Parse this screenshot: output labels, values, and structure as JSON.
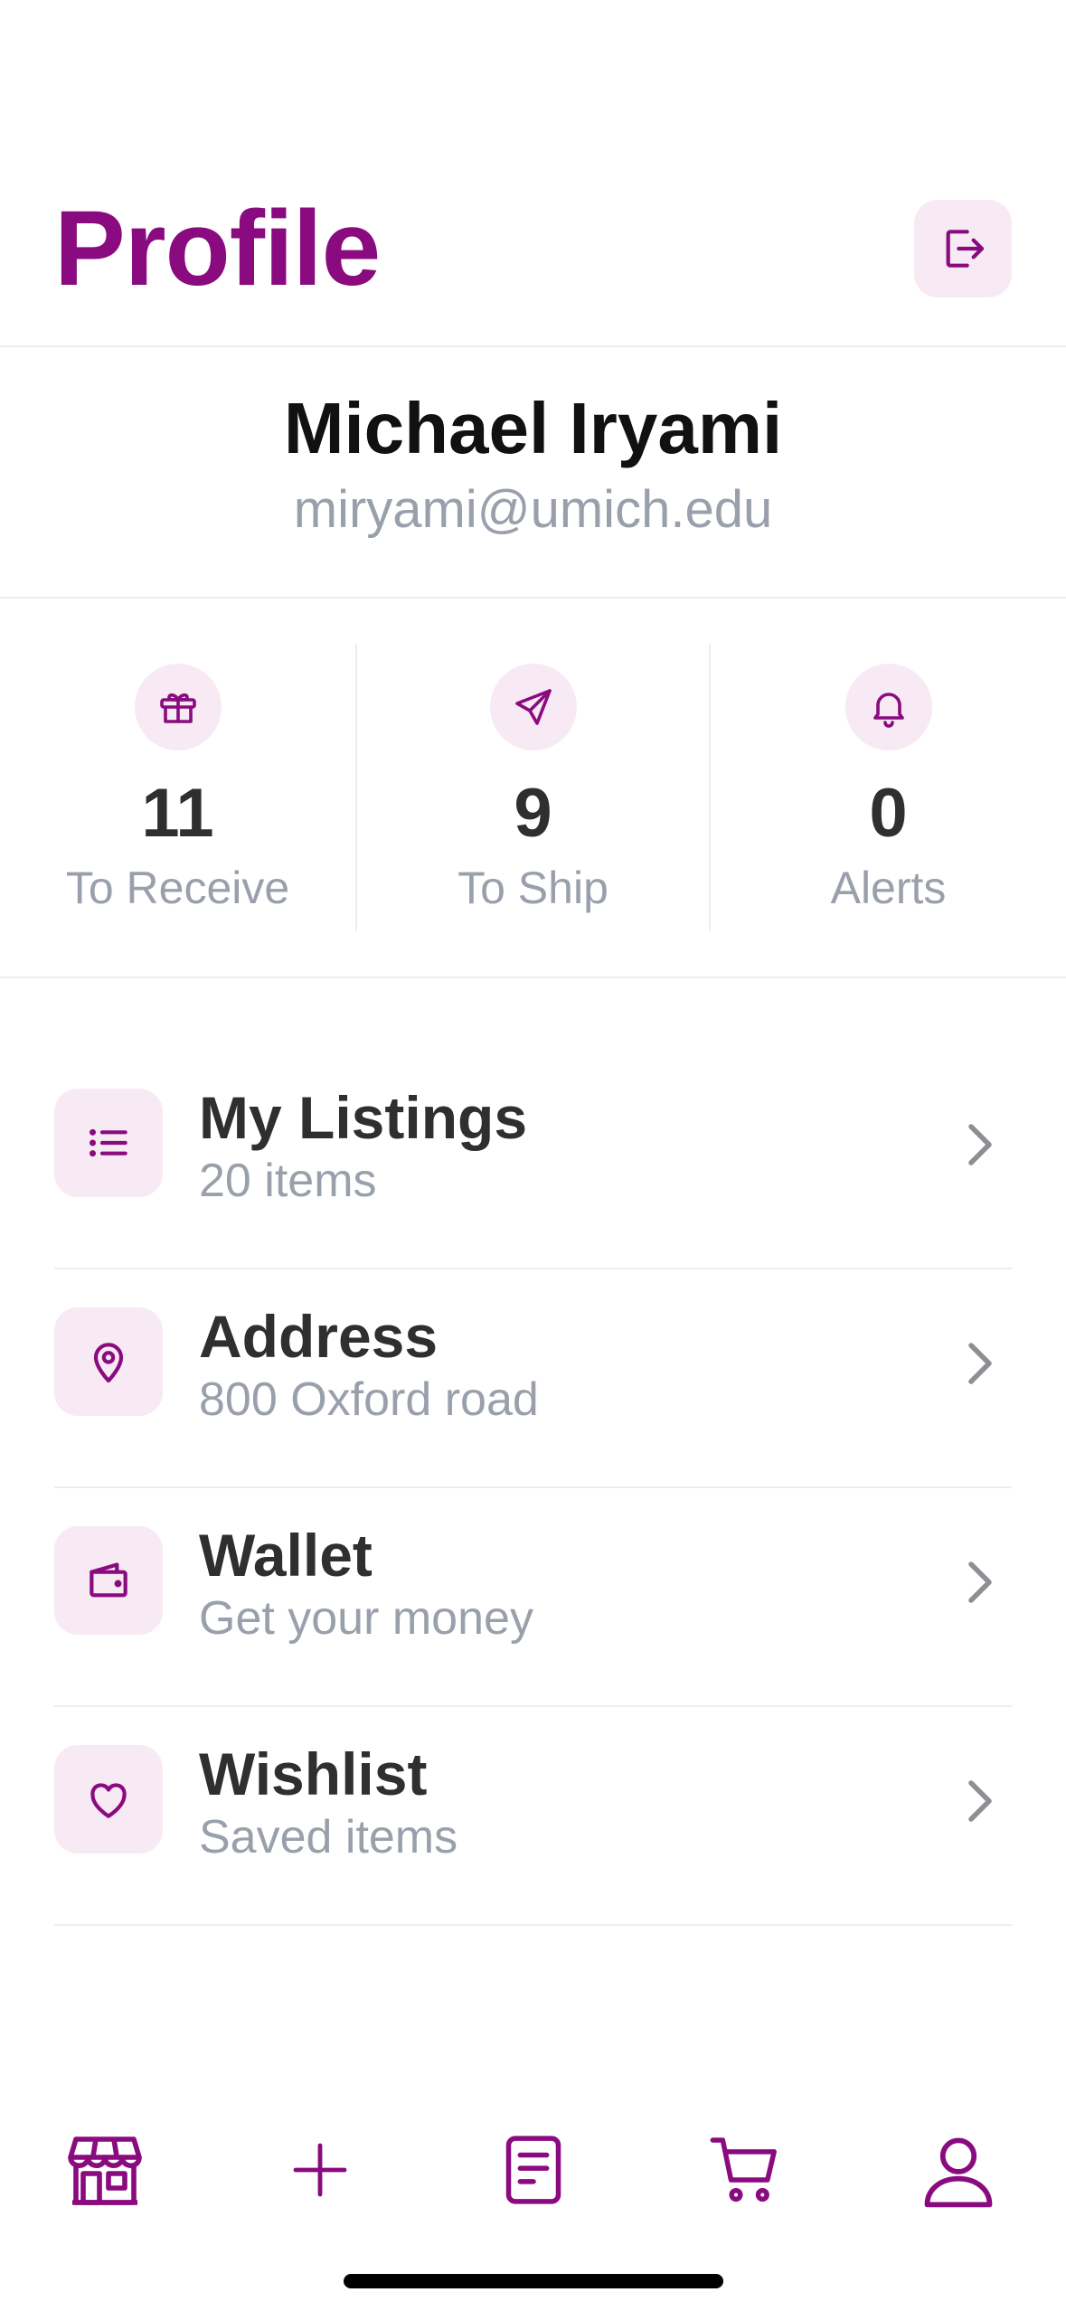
{
  "header": {
    "title": "Profile",
    "logout_icon": "logout-icon"
  },
  "user": {
    "name": "Michael Iryami",
    "email": "miryami@umich.edu"
  },
  "stats": [
    {
      "icon": "gift-icon",
      "value": "11",
      "label": "To Receive"
    },
    {
      "icon": "send-icon",
      "value": "9",
      "label": "To Ship"
    },
    {
      "icon": "bell-icon",
      "value": "0",
      "label": "Alerts"
    }
  ],
  "menu": [
    {
      "icon": "list-icon",
      "title": "My Listings",
      "subtitle": "20 items"
    },
    {
      "icon": "location-pin-icon",
      "title": "Address",
      "subtitle": "800 Oxford road"
    },
    {
      "icon": "wallet-icon",
      "title": "Wallet",
      "subtitle": "Get your money"
    },
    {
      "icon": "heart-icon",
      "title": "Wishlist",
      "subtitle": "Saved items"
    }
  ],
  "tabbar": [
    {
      "icon": "store-icon"
    },
    {
      "icon": "plus-icon"
    },
    {
      "icon": "document-icon"
    },
    {
      "icon": "cart-icon"
    },
    {
      "icon": "user-icon"
    }
  ],
  "colors": {
    "accent": "#8a0a7f",
    "icon_bg": "#f7eaf4",
    "muted_text": "#9aa0ab",
    "divider": "#eeeeee"
  }
}
